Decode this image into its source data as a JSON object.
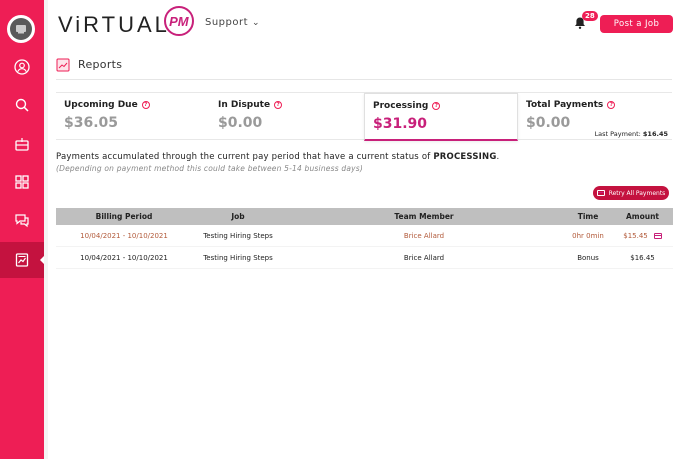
{
  "brand": {
    "logo_text": "ViRTUAL",
    "logo_badge": "PM"
  },
  "header": {
    "support_label": "Support",
    "notification_count": "28",
    "post_job_label": "Post a Job"
  },
  "page": {
    "title": "Reports"
  },
  "cards": [
    {
      "label": "Upcoming Due",
      "value": "$36.05"
    },
    {
      "label": "In Dispute",
      "value": "$0.00"
    },
    {
      "label": "Processing",
      "value": "$31.90"
    },
    {
      "label": "Total Payments",
      "value": "$0.00"
    }
  ],
  "last_payment": {
    "label": "Last Payment:",
    "value": "$16.45"
  },
  "note": {
    "text": "Payments accumulated through the current pay period that have a current status of",
    "status": "PROCESSING",
    "sub": "(Depending on payment method this could take between 5-14 business days)"
  },
  "retry_label": "Retry All Payments",
  "table": {
    "headers": [
      "Billing Period",
      "Job",
      "Team Member",
      "Time",
      "Amount"
    ],
    "rows": [
      {
        "period": "10/04/2021 - 10/10/2021",
        "job": "Testing Hiring Steps",
        "member": "Brice Allard",
        "time": "0hr 0min",
        "amount": "$15.45"
      },
      {
        "period": "10/04/2021 - 10/10/2021",
        "job": "Testing Hiring Steps",
        "member": "Brice Allard",
        "time": "Bonus",
        "amount": "$16.45"
      }
    ]
  },
  "colors": {
    "brand": "#ee1e55",
    "accent": "#c8207a",
    "sidebar_active": "#c4123f"
  },
  "icons": [
    "avatar-icon",
    "profile-icon",
    "search-icon",
    "inbox-icon",
    "grid-icon",
    "chat-icon",
    "reports-icon",
    "bell-icon",
    "card-icon",
    "help-icon"
  ]
}
